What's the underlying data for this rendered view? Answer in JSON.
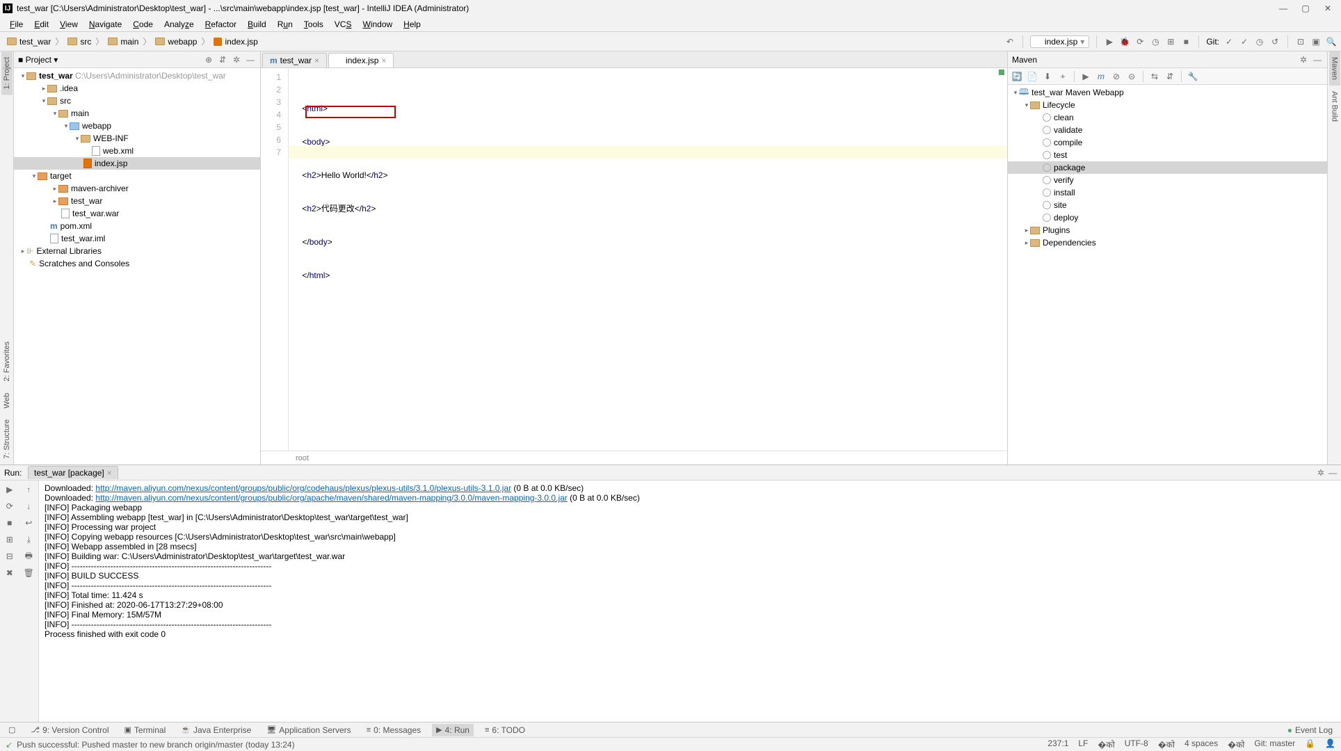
{
  "titlebar": {
    "project": "test_war",
    "path": "[C:\\Users\\Administrator\\Desktop\\test_war] - ...\\src\\main\\webapp\\index.jsp [test_war] - IntelliJ IDEA (Administrator)"
  },
  "menubar": [
    "File",
    "Edit",
    "View",
    "Navigate",
    "Code",
    "Analyze",
    "Refactor",
    "Build",
    "Run",
    "Tools",
    "VCS",
    "Window",
    "Help"
  ],
  "breadcrumbs": [
    {
      "type": "folder",
      "name": "test_war"
    },
    {
      "type": "folder",
      "name": "src"
    },
    {
      "type": "folder",
      "name": "main"
    },
    {
      "type": "folder",
      "name": "webapp"
    },
    {
      "type": "jsp",
      "name": "index.jsp"
    }
  ],
  "run_config": "index.jsp",
  "git_label": "Git:",
  "project_panel": {
    "title": "Project",
    "root": {
      "name": "test_war",
      "hint": "C:\\Users\\Administrator\\Desktop\\test_war"
    },
    "tree": {
      "idea": ".idea",
      "src": "src",
      "main": "main",
      "webapp": "webapp",
      "webinf": "WEB-INF",
      "webxml": "web.xml",
      "indexjsp": "index.jsp",
      "target": "target",
      "mavenarch": "maven-archiver",
      "test_war_dir": "test_war",
      "test_war_war": "test_war.war",
      "pom": "pom.xml",
      "iml": "test_war.iml",
      "extlib": "External Libraries",
      "scratch": "Scratches and Consoles"
    }
  },
  "editor": {
    "tab1": "test_war",
    "tab2": "index.jsp",
    "lines": [
      "<html>",
      "<body>",
      "<h2>Hello World!</h2>",
      "<h2>代码更改</h2>",
      "</body>",
      "</html>",
      ""
    ],
    "breadcrumb": "root"
  },
  "maven": {
    "title": "Maven",
    "root": "test_war Maven Webapp",
    "lifecycle": "Lifecycle",
    "phases": [
      "clean",
      "validate",
      "compile",
      "test",
      "package",
      "verify",
      "install",
      "site",
      "deploy"
    ],
    "plugins": "Plugins",
    "deps": "Dependencies"
  },
  "run": {
    "title": "Run:",
    "config": "test_war [package]",
    "lines": [
      {
        "t": "Downloaded: ",
        "url": "http://maven.aliyun.com/nexus/content/groups/public/org/codehaus/plexus/plexus-utils/3.1.0/plexus-utils-3.1.0.jar",
        "after": " (0 B at 0.0 KB/sec)"
      },
      {
        "t": "Downloaded: ",
        "url": "http://maven.aliyun.com/nexus/content/groups/public/org/apache/maven/shared/maven-mapping/3.0.0/maven-mapping-3.0.0.jar",
        "after": " (0 B at 0.0 KB/sec)"
      },
      {
        "t": "[INFO] Packaging webapp"
      },
      {
        "t": "[INFO] Assembling webapp [test_war] in [C:\\Users\\Administrator\\Desktop\\test_war\\target\\test_war]"
      },
      {
        "t": "[INFO] Processing war project"
      },
      {
        "t": "[INFO] Copying webapp resources [C:\\Users\\Administrator\\Desktop\\test_war\\src\\main\\webapp]"
      },
      {
        "t": "[INFO] Webapp assembled in [28 msecs]"
      },
      {
        "t": "[INFO] Building war: C:\\Users\\Administrator\\Desktop\\test_war\\target\\test_war.war"
      },
      {
        "t": "[INFO] ------------------------------------------------------------------------"
      },
      {
        "t": "[INFO] BUILD SUCCESS"
      },
      {
        "t": "[INFO] ------------------------------------------------------------------------"
      },
      {
        "t": "[INFO] Total time: 11.424 s"
      },
      {
        "t": "[INFO] Finished at: 2020-06-17T13:27:29+08:00"
      },
      {
        "t": "[INFO] Final Memory: 15M/57M"
      },
      {
        "t": "[INFO] ------------------------------------------------------------------------"
      },
      {
        "t": ""
      },
      {
        "t": "Process finished with exit code 0"
      }
    ]
  },
  "bottom_tools": {
    "vc": "9: Version Control",
    "term": "Terminal",
    "je": "Java Enterprise",
    "as": "Application Servers",
    "msg": "0: Messages",
    "run": "4: Run",
    "todo": "6: TODO",
    "event": "Event Log"
  },
  "status": {
    "msg": "Push successful: Pushed master to new branch origin/master (today 13:24)",
    "pos": "237:1",
    "lf": "LF",
    "enc": "UTF-8",
    "indent": "4 spaces",
    "git": "Git: master"
  },
  "side_tabs": {
    "project": "1: Project",
    "fav": "2: Favorites",
    "web": "Web",
    "struct": "7: Structure",
    "maven": "Maven",
    "ant": "Ant Build"
  }
}
